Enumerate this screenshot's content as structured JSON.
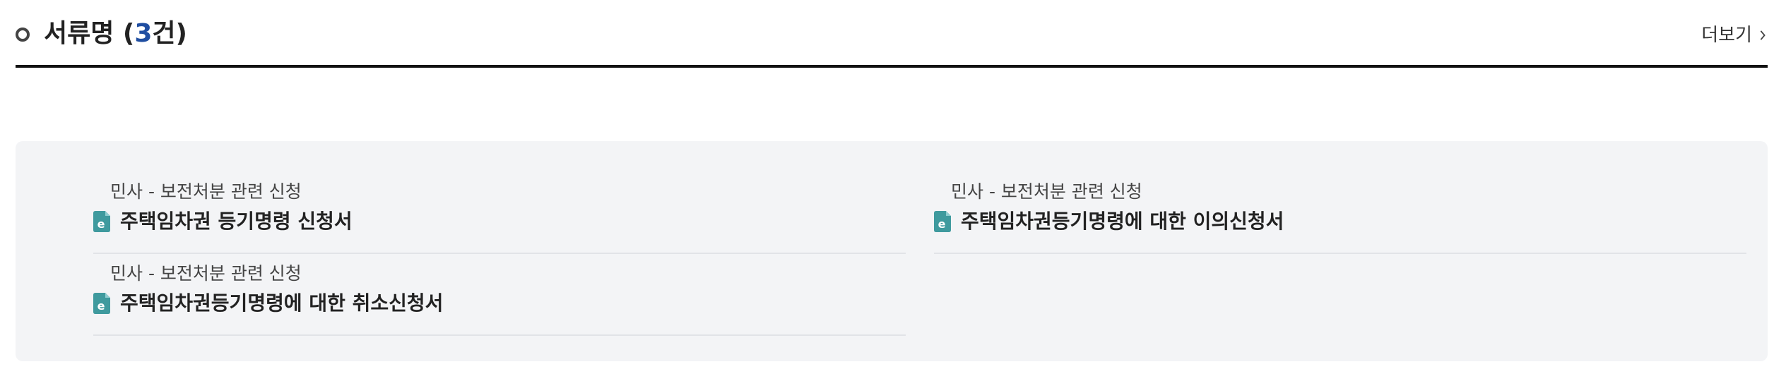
{
  "header": {
    "title_prefix": "서류명 (",
    "count": "3",
    "title_suffix": "건)",
    "more_label": "더보기"
  },
  "documents": [
    {
      "category": "민사 - 보전처분 관련 신청",
      "name": "주택임차권 등기명령 신청서"
    },
    {
      "category": "민사 - 보전처분 관련 신청",
      "name": "주택임차권등기명령에 대한 취소신청서"
    },
    {
      "category": "민사 - 보전처분 관련 신청",
      "name": "주택임차권등기명령에 대한 이의신청서"
    }
  ],
  "icons": {
    "title_bullet": "circle-bullet-icon",
    "more": "chevron-right-icon",
    "file": "e-document-icon"
  },
  "colors": {
    "count": "#1f4ea1",
    "file_icon": "#3f9a9e",
    "panel_bg": "#f3f4f6"
  }
}
